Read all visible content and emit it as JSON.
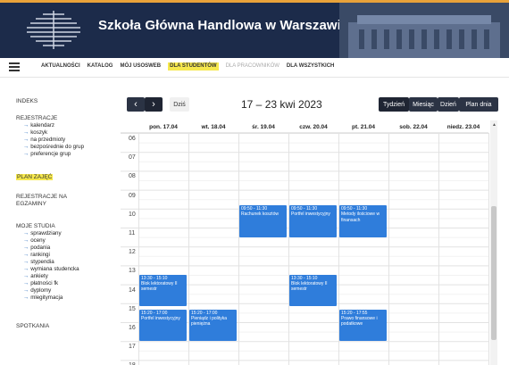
{
  "header": {
    "title": "Szkoła Główna Handlowa w Warszawie"
  },
  "nav": {
    "items": [
      "AKTUALNOŚCI",
      "KATALOG",
      "MÓJ USOSWEB",
      "DLA STUDENTÓW",
      "DLA PRACOWNIKÓW",
      "DLA WSZYSTKICH"
    ],
    "active": "DLA STUDENTÓW"
  },
  "sidebar": {
    "indeks": "INDEKS",
    "rejestracje": "REJESTRACJE",
    "rejestracje_items": [
      "kalendarz",
      "koszyk",
      "na przedmioty",
      "bezpośrednie do grup",
      "preferencje grup"
    ],
    "plan": "PLAN ZAJĘĆ",
    "rej_egz_1": "REJESTRACJE NA",
    "rej_egz_2": "EGZAMINY",
    "moje_studia": "MOJE STUDIA",
    "moje_items": [
      "sprawdziany",
      "oceny",
      "podania",
      "rankingi",
      "stypendia",
      "wymiana studencka",
      "ankiety",
      "płatności fk",
      "dyplomy",
      "mlegitymacja"
    ],
    "spotkania": "SPOTKANIA"
  },
  "toolbar": {
    "prev": "‹",
    "next": "›",
    "today": "Dziś",
    "range": "17 – 23 kwi 2023",
    "views": [
      "Tydzień",
      "Miesiąc",
      "Dzień",
      "Plan dnia"
    ]
  },
  "calendar": {
    "days": [
      "pon. 17.04",
      "wt. 18.04",
      "śr. 19.04",
      "czw. 20.04",
      "pt. 21.04",
      "sob. 22.04",
      "niedz. 23.04"
    ],
    "hours": [
      "06",
      "07",
      "08",
      "09",
      "10",
      "11",
      "12",
      "13",
      "14",
      "15",
      "16",
      "17",
      "18"
    ],
    "events": [
      {
        "day": 2,
        "start": 9.83,
        "end": 11.5,
        "time": "09:50 - 11:30",
        "title": "Rachunek kosztów"
      },
      {
        "day": 3,
        "start": 9.83,
        "end": 11.5,
        "time": "09:50 - 11:30",
        "title": "Portfel inwestycyjny"
      },
      {
        "day": 4,
        "start": 9.83,
        "end": 11.5,
        "time": "09:50 - 11:30",
        "title": "Metody ilościowe w finansach"
      },
      {
        "day": 0,
        "start": 13.5,
        "end": 15.17,
        "time": "13:30 - 15:10",
        "title": "Blok lektoratowy II semestr"
      },
      {
        "day": 3,
        "start": 13.5,
        "end": 15.17,
        "time": "13:30 - 15:10",
        "title": "Blok lektoratowy II semestr"
      },
      {
        "day": 0,
        "start": 15.33,
        "end": 17.0,
        "time": "15:20 - 17:00",
        "title": "Portfel inwestycyjny"
      },
      {
        "day": 1,
        "start": 15.33,
        "end": 17.0,
        "time": "15:20 - 17:00",
        "title": "Pieniądz i polityka pieniężna"
      },
      {
        "day": 4,
        "start": 15.33,
        "end": 17.0,
        "time": "15:20 - 17:55",
        "title": "Prawo finansowe i podatkowe"
      }
    ],
    "event_color": "#2f7ddb"
  }
}
